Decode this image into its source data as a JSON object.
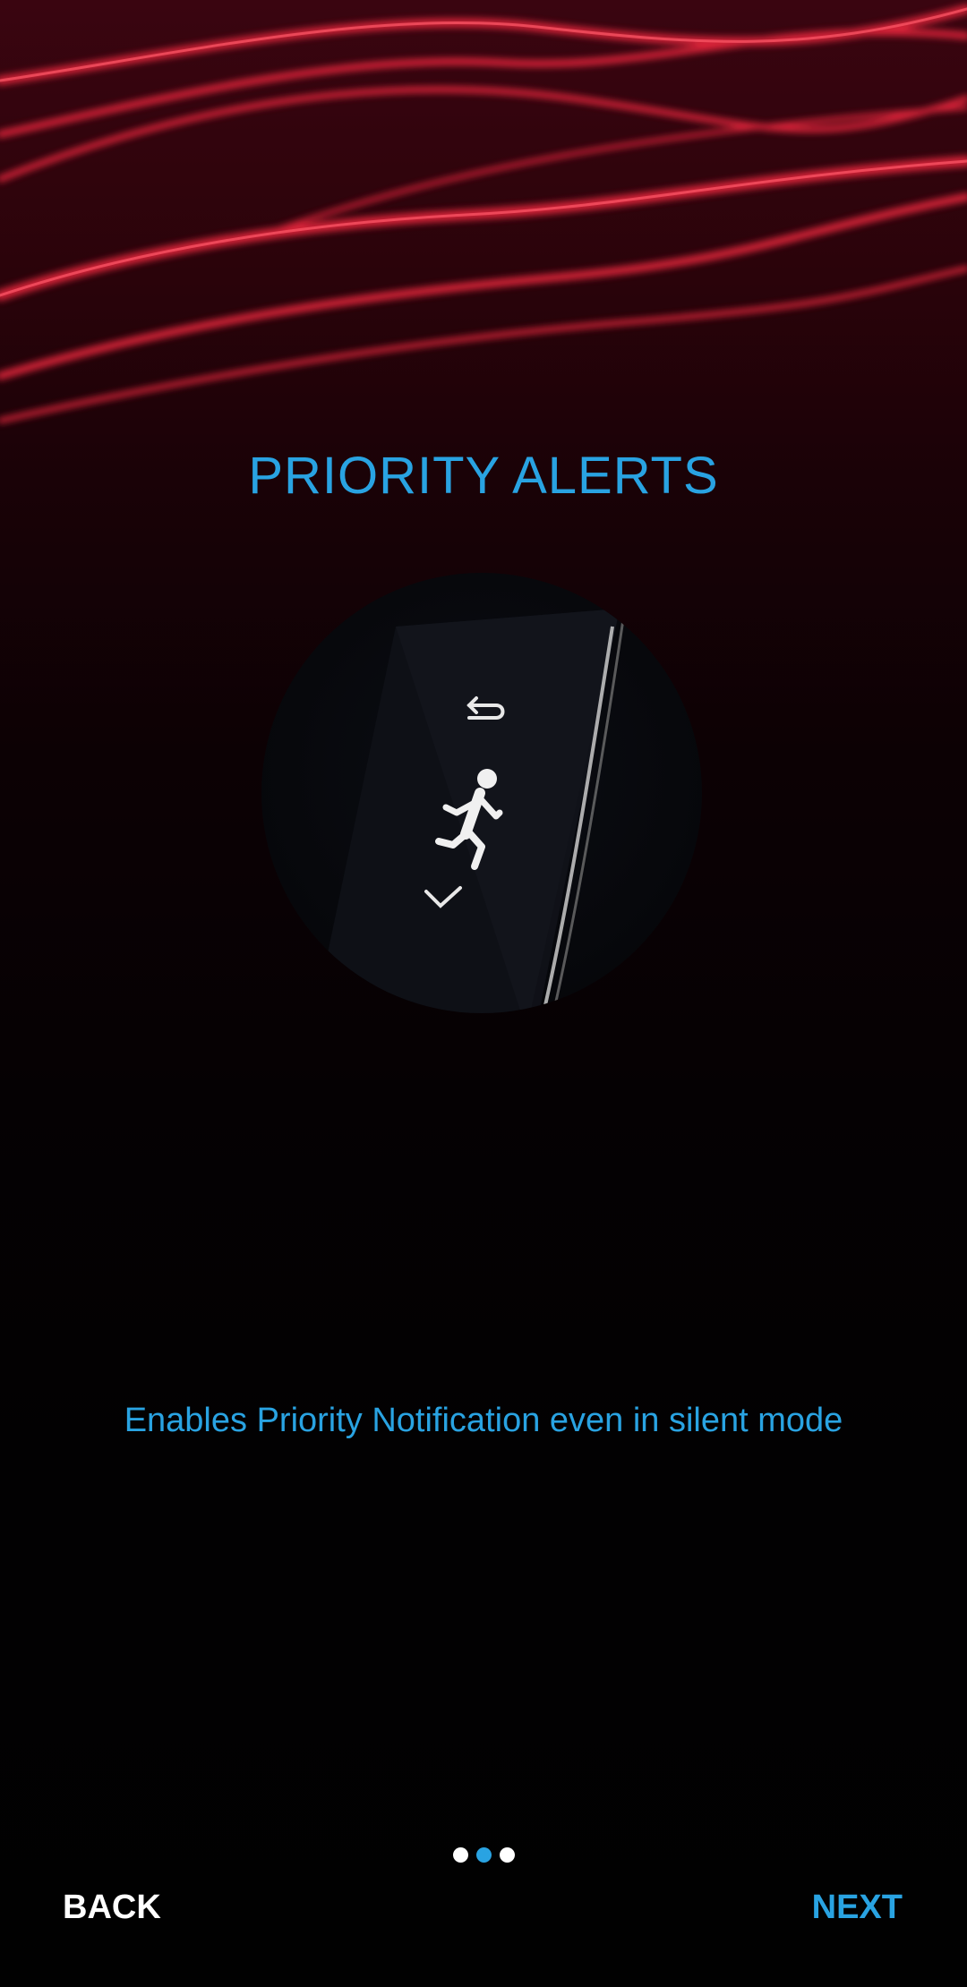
{
  "colors": {
    "accent": "#29a3e2",
    "light_streaks": "#e8253c",
    "background": "#000000",
    "inactive_dot": "#ffffff"
  },
  "onboarding": {
    "title": "PRIORITY ALERTS",
    "illustration_icon": "running-person-icon",
    "description": "Enables Priority Notification even in silent mode"
  },
  "pager": {
    "total": 3,
    "active_index": 1
  },
  "footer": {
    "back_label": "BACK",
    "next_label": "NEXT"
  }
}
